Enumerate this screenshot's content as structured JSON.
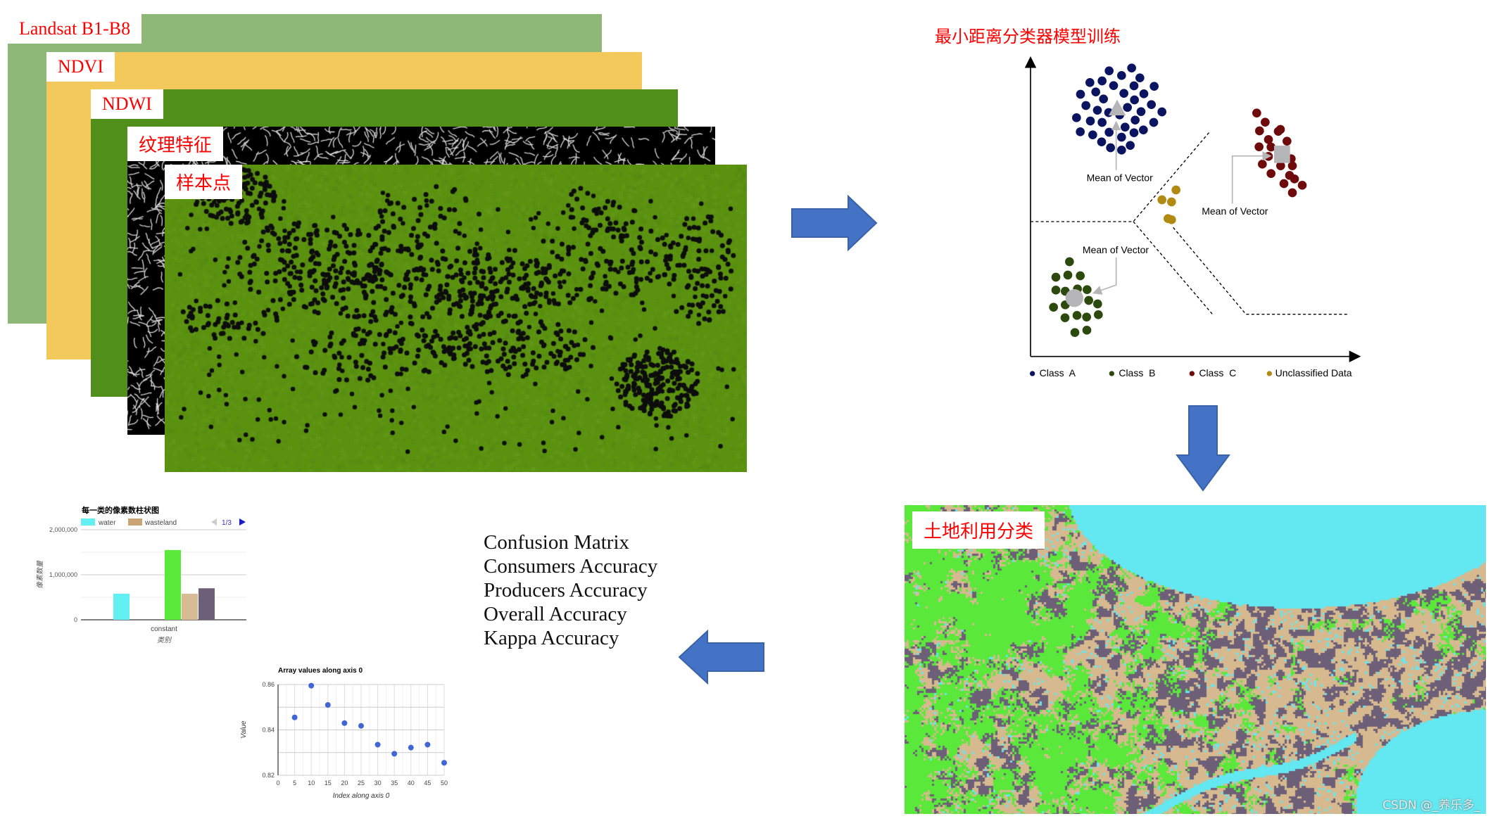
{
  "layers": [
    {
      "label": "Landsat B1-B8",
      "color": "#8db877"
    },
    {
      "label": "NDVI",
      "color": "#f2c95a"
    },
    {
      "label": "NDWI",
      "color": "#4f8f1a"
    },
    {
      "label": "纹理特征",
      "color": "#000000"
    },
    {
      "label": "样本点",
      "color": "#5a9210"
    }
  ],
  "arrows": {
    "color": "#4472c4",
    "icons": [
      "arrow-right-icon",
      "arrow-down-icon",
      "arrow-left-icon"
    ]
  },
  "classifier": {
    "title": "最小距离分类器模型训练",
    "mean_labels": [
      "Mean of Vector",
      "Mean of Vector",
      "Mean of Vector"
    ],
    "legend": [
      {
        "label": "Class  A",
        "color": "#0b1460"
      },
      {
        "label": "Class  B",
        "color": "#2d4a0e"
      },
      {
        "label": "Class  C",
        "color": "#6e0a0a"
      },
      {
        "label": "Unclassified Data",
        "color": "#b08a12"
      }
    ]
  },
  "land_use_map": {
    "title": "土地利用分类",
    "class_colors": {
      "water": "#63e8f2",
      "vegetation": "#5ae83a",
      "wasteland": "#d6b98f",
      "built": "#6e5f78"
    },
    "watermark": "CSDN @_养乐多_"
  },
  "metrics": [
    "Confusion Matrix",
    "Consumers Accuracy",
    "Producers Accuracy",
    "Overall Accuracy",
    "Kappa Accuracy"
  ],
  "chart_data": [
    {
      "type": "bar",
      "title": "每一类的像素数柱状图",
      "categories": [
        "constant"
      ],
      "xlabel": "类别",
      "ylabel": "像素数量",
      "ylim": [
        0,
        2000000
      ],
      "yticks": [
        "0",
        "1,000,000",
        "2,000,000"
      ],
      "legend_page": "1/3",
      "legend_placement": "top",
      "series": [
        {
          "name": "water",
          "color": "#63f0f2",
          "values": [
            580000
          ]
        },
        {
          "color": "#5ae83a",
          "values": [
            1550000
          ]
        },
        {
          "name": "wasteland",
          "color": "#d6bb94",
          "values": [
            580000
          ]
        },
        {
          "color": "#6e5f78",
          "values": [
            700000
          ]
        }
      ]
    },
    {
      "type": "scatter",
      "title": "Array values along axis 0",
      "xlabel": "Index along axis 0",
      "ylabel": "Value",
      "xlim": [
        0,
        50
      ],
      "ylim": [
        0.82,
        0.86
      ],
      "xticks": [
        "0",
        "5",
        "10",
        "15",
        "20",
        "25",
        "30",
        "35",
        "40",
        "45",
        "50"
      ],
      "yticks": [
        "0.82",
        "0.84",
        "0.86"
      ],
      "grid": true,
      "color": "#3f66d4",
      "x": [
        5,
        10,
        15,
        20,
        25,
        30,
        35,
        40,
        45,
        50
      ],
      "y": [
        0.8455,
        0.8595,
        0.851,
        0.843,
        0.8418,
        0.8335,
        0.8295,
        0.8322,
        0.8335,
        0.8255
      ]
    }
  ]
}
